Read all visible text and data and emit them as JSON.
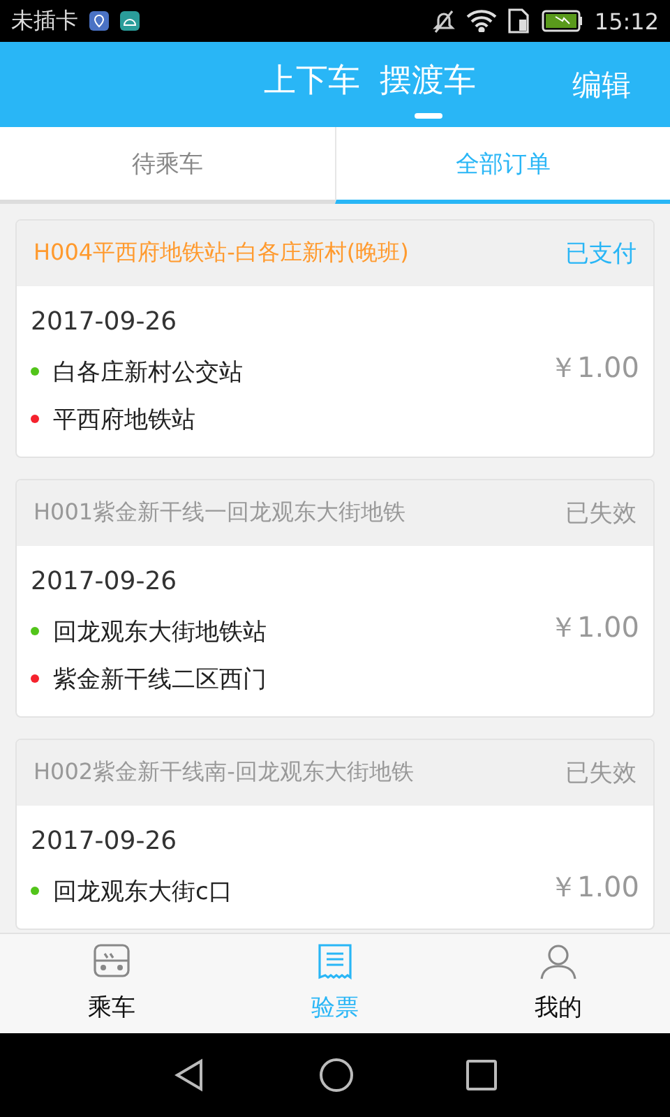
{
  "status_bar": {
    "carrier": "未插卡",
    "time": "15:12"
  },
  "header": {
    "tabs": [
      {
        "label": "上下车",
        "selected": false
      },
      {
        "label": "摆渡车",
        "selected": true
      }
    ],
    "action": "编辑"
  },
  "sub_tabs": [
    {
      "label": "待乘车",
      "selected": false
    },
    {
      "label": "全部订单",
      "selected": true
    }
  ],
  "orders": [
    {
      "title": "H004平西府地铁站-白各庄新村(晚班)",
      "status": "已支付",
      "kind": "paid",
      "date": "2017-09-26",
      "price": "￥1.00",
      "stops": [
        {
          "name": "白各庄新村公交站",
          "color": "#52c41a"
        },
        {
          "name": "平西府地铁站",
          "color": "#f5222d"
        }
      ]
    },
    {
      "title": "H001紫金新干线一回龙观东大街地铁",
      "status": "已失效",
      "kind": "expired",
      "date": "2017-09-26",
      "price": "￥1.00",
      "stops": [
        {
          "name": "回龙观东大街地铁站",
          "color": "#52c41a"
        },
        {
          "name": "紫金新干线二区西门",
          "color": "#f5222d"
        }
      ]
    },
    {
      "title": "H002紫金新干线南-回龙观东大街地铁",
      "status": "已失效",
      "kind": "expired",
      "date": "2017-09-26",
      "price": "￥1.00",
      "stops": [
        {
          "name": "回龙观东大街c口",
          "color": "#52c41a"
        }
      ]
    }
  ],
  "bottom_nav": [
    {
      "label": "乘车",
      "kind": "bus",
      "selected": false
    },
    {
      "label": "验票",
      "kind": "ticket",
      "selected": true
    },
    {
      "label": "我的",
      "kind": "person",
      "selected": false
    }
  ]
}
